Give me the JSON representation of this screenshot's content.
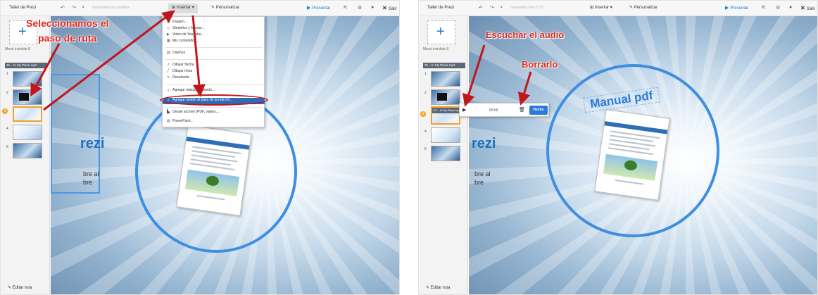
{
  "left": {
    "app_title": "Taller de Prezi",
    "save_status": "Guardando los cambios",
    "toolbar": {
      "insert_label": "Insertar ▾",
      "customize_label": "Personalizar",
      "present_label": "Presentar",
      "exit_label": "Salir"
    },
    "sidebar": {
      "add_frame_symbol": "+",
      "menu_label": "Menú invisible 8",
      "audio_label": "32 – In My Place.mp3",
      "thumbnails": [
        "1",
        "2",
        "3",
        "4",
        "5"
      ],
      "selected_step": "3",
      "edit_path_label": "Editar ruta"
    },
    "canvas": {
      "prezi_text": "rezi",
      "side_text_1": "bre al",
      "side_text_2": "bre"
    },
    "insert_menu": {
      "items": [
        {
          "icon": "▣",
          "label": "Imagen..."
        },
        {
          "icon": "◇",
          "label": "Símbolos y formas..."
        },
        {
          "icon": "▶",
          "label": "Video de YouTube..."
        },
        {
          "icon": "▦",
          "label": "Mis contenidos..."
        },
        {
          "icon": "▤",
          "label": "Diseños"
        },
        {
          "icon": "➚",
          "label": "Dibujar flecha"
        },
        {
          "icon": "╱",
          "label": "Dibujar línea"
        },
        {
          "icon": "✎",
          "label": "Resaltador"
        },
        {
          "icon": "♫",
          "label": "Agregar música de fondo..."
        },
        {
          "icon": "♫",
          "label": "Agregar sonido al paso de la ruta #3..."
        },
        {
          "icon": "▙",
          "label": "Desde archivo (PDF, videos,..."
        },
        {
          "icon": "▨",
          "label": "PowerPoint..."
        }
      ]
    },
    "annotation": "Seleccionamos el\npaso de ruta"
  },
  "right": {
    "app_title": "Taller de Prezi",
    "save_status": "Guardado a las 07:51",
    "toolbar": {
      "insert_label": "Insertar ▾",
      "customize_label": "Personalizar",
      "present_label": "Presentar",
      "exit_label": "Salir"
    },
    "sidebar": {
      "add_frame_symbol": "+",
      "menu_label": "Menú invisible 8",
      "audio_label": "32 – In My Place.mp3",
      "step_audio_label": "32 – In My Place.mp3",
      "thumbnails": [
        "1",
        "2",
        "3",
        "4",
        "5"
      ],
      "selected_step": "3",
      "edit_path_label": "Editar ruta"
    },
    "canvas": {
      "prezi_text": "rezi",
      "side_text_1": "bre al",
      "side_text_2": "bre",
      "manual_label": "Manual pdf"
    },
    "audio_popup": {
      "play_symbol": "▶",
      "time": "00:00",
      "delete_symbol": "🗑",
      "done_label": "Hecho"
    },
    "annotations": {
      "listen": "Escuchar el audio",
      "delete": "Borrarlo"
    }
  },
  "colors": {
    "accent_blue": "#2b7ad9",
    "annotation_red": "#e02a22",
    "path_orange": "#f4a61d"
  }
}
